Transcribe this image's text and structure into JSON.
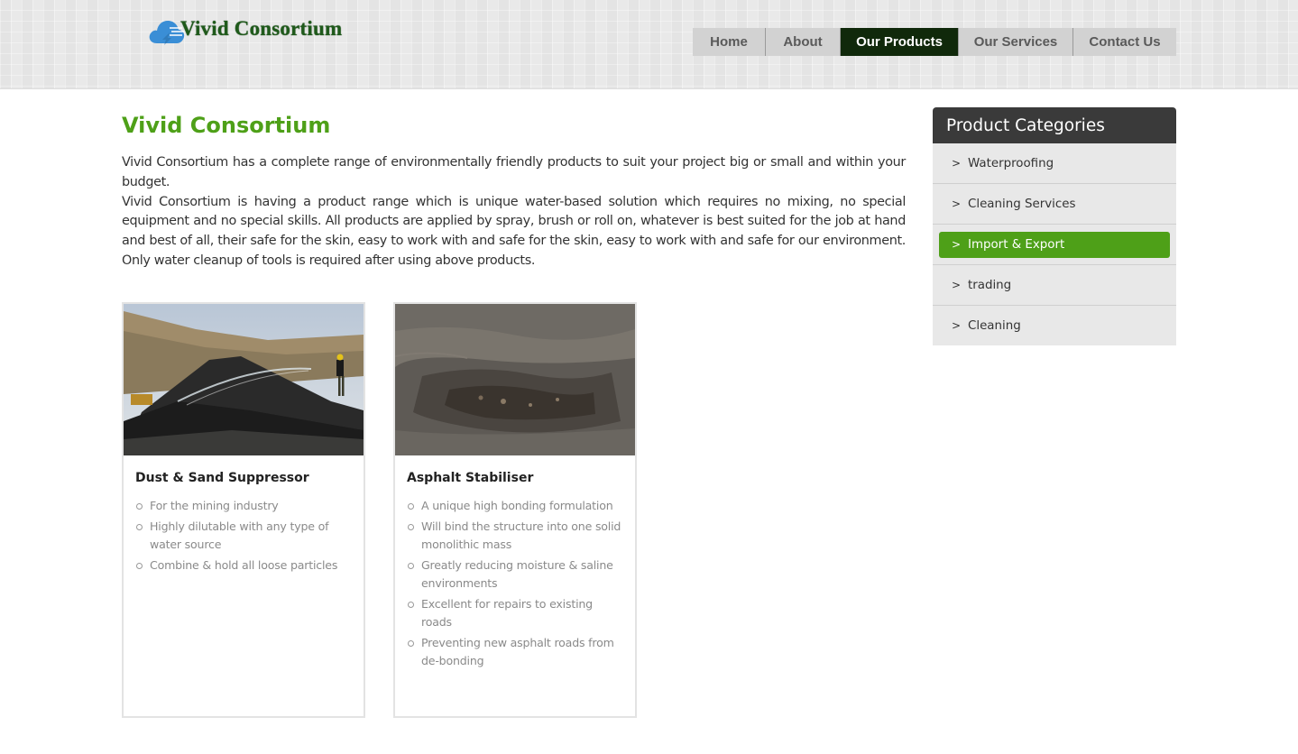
{
  "brand": {
    "name": "Vivid Consortium",
    "accent_color": "#4ea018",
    "nav_active_color": "#10290b"
  },
  "nav": {
    "items": [
      {
        "label": "Home",
        "active": false
      },
      {
        "label": "About",
        "active": false
      },
      {
        "label": "Our Products",
        "active": true
      },
      {
        "label": "Our Services",
        "active": false
      },
      {
        "label": "Contact Us",
        "active": false
      }
    ]
  },
  "main": {
    "title": "Vivid Consortium",
    "paragraph_1": "Vivid Consortium has a complete range of environmentally friendly products to suit your project big or small and within your budget.",
    "paragraph_2": "Vivid Consortium is having a product range which is unique water-based solution which requires no mixing, no special equipment and no special skills. All products are applied by spray, brush or roll on, whatever is best suited for the job at hand and best of all, their safe for the skin, easy to work with and safe for the skin, easy to work with and safe for our environment. Only water cleanup of tools is required after using above products."
  },
  "products": [
    {
      "title": "Dust & Sand Suppressor",
      "features": [
        "For the mining industry",
        "Highly dilutable with any type of water source",
        "Combine & hold all loose particles"
      ]
    },
    {
      "title": "Asphalt Stabiliser",
      "features": [
        "A unique high bonding formulation",
        "Will bind the structure into one solid monolithic mass",
        "Greatly reducing moisture & saline environments",
        "Excellent for repairs to existing roads",
        "Preventing new asphalt roads from de-bonding"
      ]
    }
  ],
  "sidebar": {
    "title": "Product Categories",
    "arrow": ">",
    "items": [
      {
        "label": "Waterproofing",
        "active": false
      },
      {
        "label": "Cleaning Services",
        "active": false
      },
      {
        "label": "Import & Export",
        "active": true
      },
      {
        "label": "trading",
        "active": false
      },
      {
        "label": "Cleaning",
        "active": false
      }
    ]
  }
}
